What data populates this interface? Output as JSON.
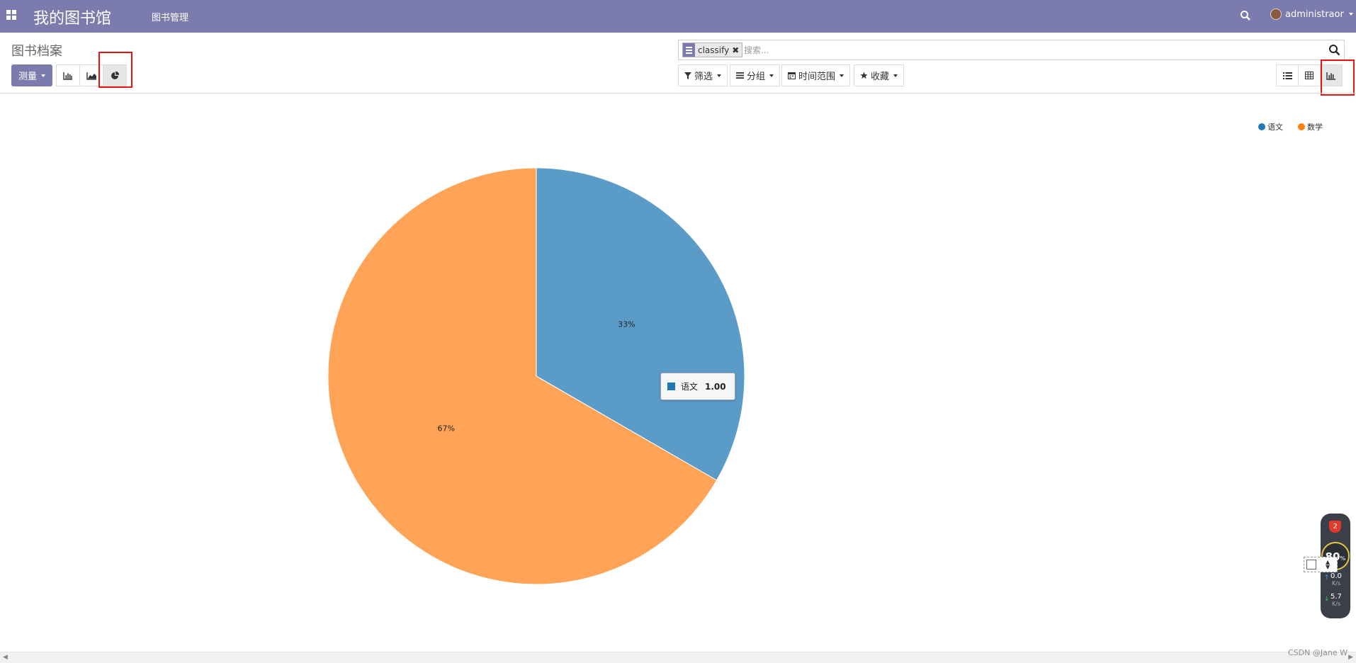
{
  "navbar": {
    "app_title": "我的图书馆",
    "menu_item": "图书管理",
    "user_name": "administraor",
    "bg_color": "#7c7bad"
  },
  "control_panel": {
    "breadcrumb": "图书档案",
    "measure_label": "测量",
    "chart_types": [
      {
        "name": "bar-chart-icon",
        "active": false
      },
      {
        "name": "line-chart-icon",
        "active": false
      },
      {
        "name": "pie-chart-icon",
        "active": true
      }
    ],
    "search": {
      "facet_value": "classify",
      "facet_remove": "✖",
      "placeholder": "搜索..."
    },
    "filters": {
      "filter_label": "筛选",
      "group_label": "分组",
      "time_range_label": "时间范围",
      "favorites_label": "收藏"
    },
    "views": [
      {
        "name": "list-view-icon",
        "active": false
      },
      {
        "name": "pivot-view-icon",
        "active": false
      },
      {
        "name": "graph-view-icon",
        "active": true
      }
    ]
  },
  "chart_data": {
    "type": "pie",
    "categories": [
      "语文",
      "数学"
    ],
    "values": [
      1,
      2
    ],
    "slice_labels": [
      "33%",
      "67%"
    ],
    "colors": [
      "#5b9bc8",
      "#ffa456"
    ],
    "legend": {
      "position": "top-right",
      "entries": [
        {
          "label": "语文",
          "color": "#1f77b4"
        },
        {
          "label": "数学",
          "color": "#ff7f0e"
        }
      ]
    },
    "tooltip": {
      "key": "语文",
      "value": "1.00"
    }
  },
  "widget": {
    "badge": "2",
    "percent": "80",
    "percent_sign": "%",
    "upload_speed": "0.0",
    "download_speed": "5.7",
    "speed_unit": "K/s"
  },
  "watermark": "CSDN @Jane W"
}
